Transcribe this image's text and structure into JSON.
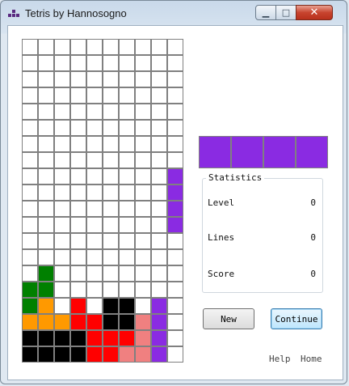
{
  "window": {
    "title": "Tetris by Hannosogno"
  },
  "colors": {
    "empty": "#ffffff",
    "purple": "#8a2be2",
    "green": "#008000",
    "orange": "#ff9900",
    "red": "#ff0000",
    "black": "#000000",
    "pink": "#f08080"
  },
  "board": {
    "columns": 10,
    "rows": [
      "..........",
      "..........",
      "..........",
      "..........",
      "..........",
      "..........",
      "..........",
      "..........",
      ".........P",
      ".........P",
      ".........P",
      ".........P",
      "..........",
      "..........",
      ".G........",
      "GG........",
      "GO.R.KK.P.",
      "OOORRKKSP.",
      "KKKKRRRSP.",
      "KKKKRRSSP."
    ]
  },
  "next_piece": {
    "rows": [
      "....",
      "....",
      "....",
      "PPPP"
    ]
  },
  "statistics": {
    "legend": "Statistics",
    "level_label": "Level",
    "level_value": "0",
    "lines_label": "Lines",
    "lines_value": "0",
    "score_label": "Score",
    "score_value": "0"
  },
  "buttons": {
    "new_label": "New",
    "continue_label": "Continue"
  },
  "links": {
    "help_label": "Help",
    "home_label": "Home"
  }
}
